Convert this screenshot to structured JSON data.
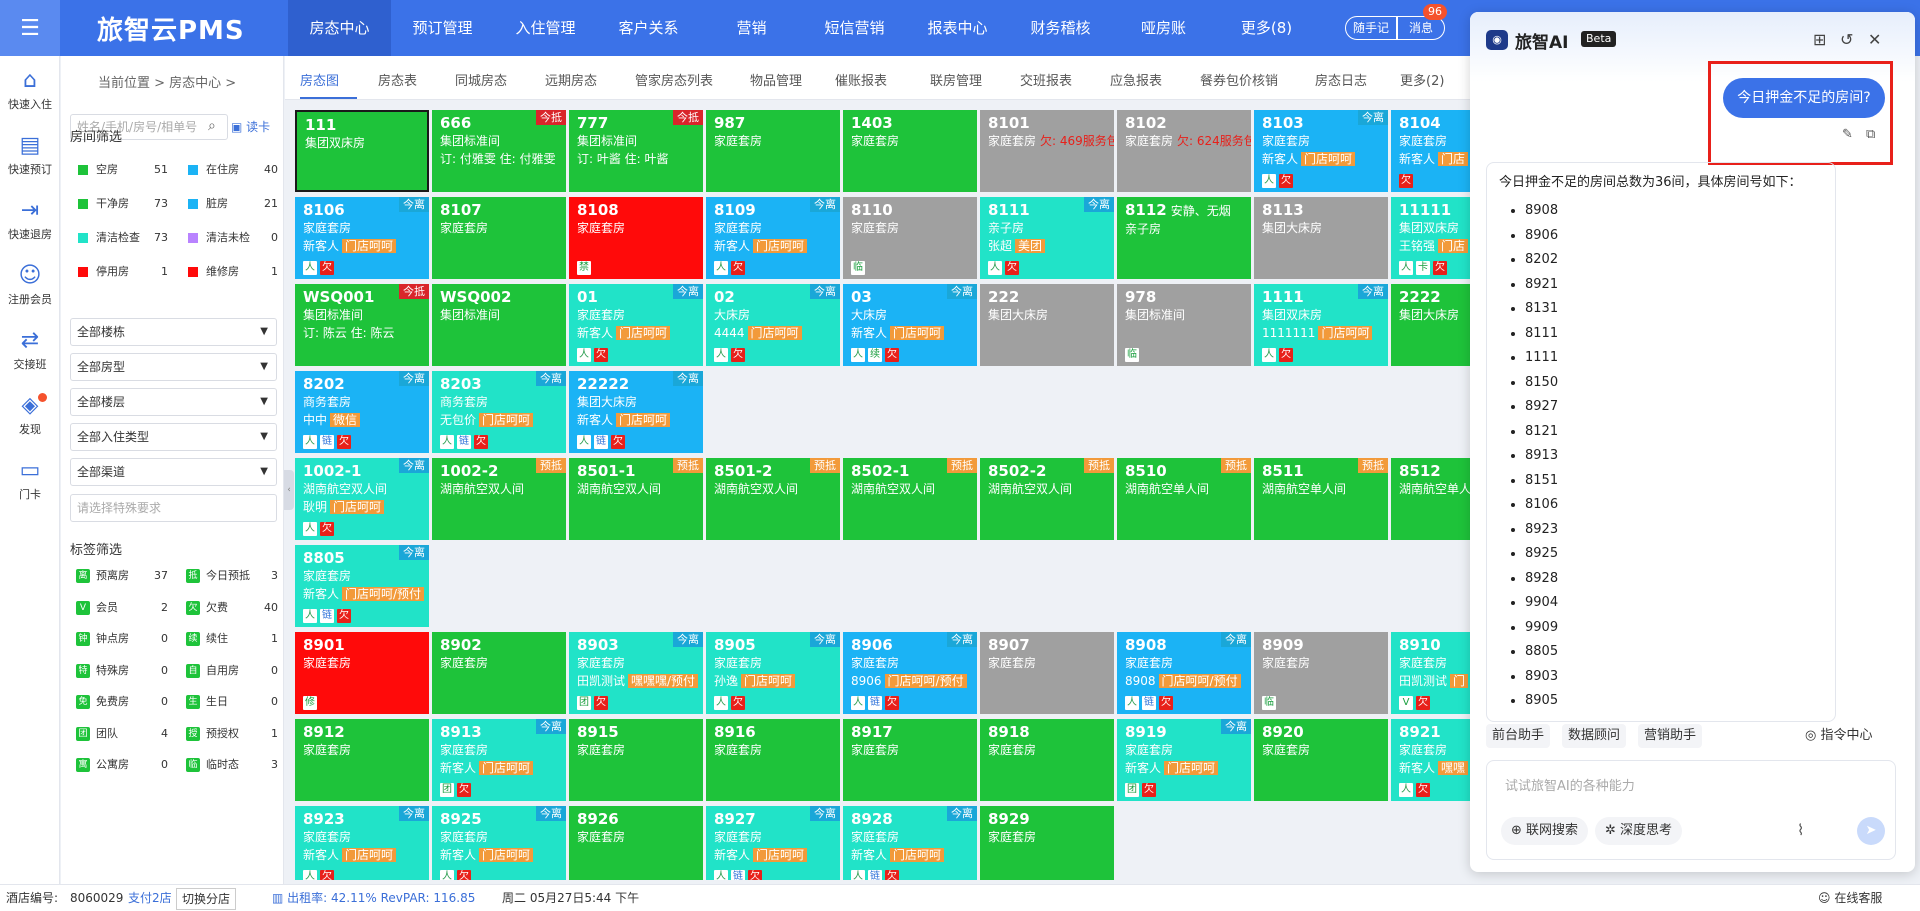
{
  "topbar": {
    "brand": "旅智云PMS",
    "nav": [
      "房态中心",
      "预订管理",
      "入住管理",
      "客户关系",
      "营销",
      "短信营销",
      "报表中心",
      "财务稽核",
      "哑房账",
      "更多(8)"
    ],
    "note_label": "随手记",
    "msg_label": "消息",
    "msg_count": "96",
    "accent_color": "#3b72e8"
  },
  "rail": [
    {
      "icon": "home-icon",
      "label": "快速入住"
    },
    {
      "icon": "booking-icon",
      "label": "快速预订"
    },
    {
      "icon": "checkout-icon",
      "label": "快速退房"
    },
    {
      "icon": "member-icon",
      "label": "注册会员"
    },
    {
      "icon": "shift-icon",
      "label": "交接班"
    },
    {
      "icon": "discover-icon",
      "label": "发现"
    },
    {
      "icon": "card-icon",
      "label": "门卡"
    }
  ],
  "breadcrumb": "当前位置 > 房态中心 >",
  "search": {
    "placeholder": "姓名/手机/房号/相单号",
    "read_card": "读卡"
  },
  "room_filter": {
    "title": "房间筛选",
    "items": [
      {
        "label": "空房",
        "count": "51",
        "color": "#1ec33a"
      },
      {
        "label": "在住房",
        "count": "40",
        "color": "#1bb3f5"
      },
      {
        "label": "干净房",
        "count": "73",
        "color": "#1ec33a"
      },
      {
        "label": "脏房",
        "count": "21",
        "color": "#1bb3f5"
      },
      {
        "label": "清洁检查",
        "count": "73",
        "color": "#21e3c8"
      },
      {
        "label": "清洁未检",
        "count": "0",
        "color": "#b983ff"
      },
      {
        "label": "停用房",
        "count": "1",
        "color": "#ff0a0a"
      },
      {
        "label": "维修房",
        "count": "1",
        "color": "#ff0a0a"
      }
    ]
  },
  "dropdowns": [
    "全部楼栋",
    "全部房型",
    "全部楼层",
    "全部入住类型",
    "全部渠道"
  ],
  "special_placeholder": "请选择特殊要求",
  "tag_filter": {
    "title": "标签筛选",
    "items": [
      {
        "badge": "离",
        "label": "预离房",
        "count": "37",
        "color": "#1ec33a"
      },
      {
        "badge": "抵",
        "label": "今日预抵",
        "count": "3",
        "color": "#1ec33a"
      },
      {
        "badge": "V",
        "label": "会员",
        "count": "2",
        "color": "#1ec33a"
      },
      {
        "badge": "欠",
        "label": "欠费",
        "count": "40",
        "color": "#1ec33a"
      },
      {
        "badge": "钟",
        "label": "钟点房",
        "count": "0",
        "color": "#1ec33a"
      },
      {
        "badge": "续",
        "label": "续住",
        "count": "1",
        "color": "#1ec33a"
      },
      {
        "badge": "特",
        "label": "特殊房",
        "count": "0",
        "color": "#1ec33a"
      },
      {
        "badge": "自",
        "label": "自用房",
        "count": "0",
        "color": "#1ec33a"
      },
      {
        "badge": "免",
        "label": "免费房",
        "count": "0",
        "color": "#1ec33a"
      },
      {
        "badge": "生",
        "label": "生日",
        "count": "0",
        "color": "#1ec33a"
      },
      {
        "badge": "团",
        "label": "团队",
        "count": "4",
        "color": "#1ec33a"
      },
      {
        "badge": "授",
        "label": "预授权",
        "count": "1",
        "color": "#1ec33a"
      },
      {
        "badge": "寓",
        "label": "公寓房",
        "count": "0",
        "color": "#1ec33a"
      },
      {
        "badge": "临",
        "label": "临时态",
        "count": "3",
        "color": "#1ec33a"
      }
    ]
  },
  "subnav": [
    "房态图",
    "房态表",
    "同城房态",
    "远期房态",
    "管家房态列表",
    "物品管理",
    "催账报表",
    "联房管理",
    "交班报表",
    "应急报表",
    "餐券包价核销",
    "房态日志",
    "更多(2)"
  ],
  "rooms": [
    {
      "num": "111",
      "type": "集团双床房",
      "color": "green",
      "selected": true
    },
    {
      "num": "666",
      "type": "集团标准间",
      "guest": "订: 付雅雯 住: 付雅雯",
      "badge": "今抵",
      "badge_color": "red",
      "color": "green"
    },
    {
      "num": "777",
      "type": "集团标准间",
      "guest": "订: 叶酱 住: 叶酱",
      "badge": "今抵",
      "badge_color": "red",
      "color": "green"
    },
    {
      "num": "987",
      "type": "家庭套房",
      "color": "green"
    },
    {
      "num": "1403",
      "type": "家庭套房",
      "color": "green"
    },
    {
      "num": "8101",
      "type": "家庭套房",
      "warn": "欠: 469服务包",
      "color": "gray"
    },
    {
      "num": "8102",
      "type": "家庭套房",
      "warn": "欠: 624服务包",
      "color": "gray"
    },
    {
      "num": "8103",
      "type": "家庭套房",
      "guest": "新客人",
      "gtag": "门店呵呵",
      "icons": [
        "人",
        "欠"
      ],
      "badge": "今离",
      "badge_color": "blue",
      "color": "blue"
    },
    {
      "num": "8104",
      "type": "家庭套房",
      "guest": "新客人",
      "gtag": "门店",
      "icons": [
        "欠"
      ],
      "color": "blue"
    },
    {
      "num": "8106",
      "type": "家庭套房",
      "guest": "新客人",
      "gtag": "门店呵呵",
      "icons": [
        "人",
        "欠"
      ],
      "badge": "今离",
      "badge_color": "blue",
      "color": "blue"
    },
    {
      "num": "8107",
      "type": "家庭套房",
      "color": "green"
    },
    {
      "num": "8108",
      "type": "家庭套房",
      "icons": [
        "禁"
      ],
      "color": "red"
    },
    {
      "num": "8109",
      "type": "家庭套房",
      "guest": "新客人",
      "gtag": "门店呵呵",
      "icons": [
        "人",
        "欠"
      ],
      "badge": "今离",
      "badge_color": "blue",
      "color": "blue"
    },
    {
      "num": "8110",
      "type": "家庭套房",
      "icons": [
        "临"
      ],
      "color": "gray"
    },
    {
      "num": "8111",
      "type": "亲子房",
      "guest": "张超",
      "gtag": "美团",
      "icons": [
        "人",
        "欠"
      ],
      "badge": "今离",
      "badge_color": "blue",
      "color": "cyan"
    },
    {
      "num": "8112",
      "extra": "安静、无烟",
      "type": "亲子房",
      "color": "green"
    },
    {
      "num": "8113",
      "type": "集团大床房",
      "color": "gray"
    },
    {
      "num": "11111",
      "type": "集团双床房",
      "guest": "王铭强",
      "gtag": "门店",
      "icons": [
        "人",
        "卡",
        "欠"
      ],
      "color": "cyan"
    },
    {
      "num": "WSQ001",
      "type": "集团标准间",
      "guest": "订: 陈云 住: 陈云",
      "badge": "今抵",
      "badge_color": "red",
      "color": "green"
    },
    {
      "num": "WSQ002",
      "type": "集团标准间",
      "color": "green"
    },
    {
      "num": "01",
      "type": "家庭套房",
      "guest": "新客人",
      "gtag": "门店呵呵",
      "icons": [
        "人",
        "欠"
      ],
      "badge": "今离",
      "badge_color": "blue",
      "color": "cyan"
    },
    {
      "num": "02",
      "type": "大床房",
      "guest": "4444",
      "gtag": "门店呵呵",
      "icons": [
        "人",
        "欠"
      ],
      "badge": "今离",
      "badge_color": "blue",
      "color": "cyan"
    },
    {
      "num": "03",
      "type": "大床房",
      "guest": "新客人",
      "gtag": "门店呵呵",
      "icons": [
        "人",
        "续",
        "欠"
      ],
      "badge": "今离",
      "badge_color": "blue",
      "color": "blue"
    },
    {
      "num": "222",
      "type": "集团大床房",
      "color": "gray"
    },
    {
      "num": "978",
      "type": "集团标准间",
      "icons": [
        "临"
      ],
      "color": "gray"
    },
    {
      "num": "1111",
      "type": "集团双床房",
      "guest": "1111111",
      "gtag": "门店呵呵",
      "icons": [
        "人",
        "欠"
      ],
      "badge": "今离",
      "badge_color": "blue",
      "color": "cyan"
    },
    {
      "num": "2222",
      "type": "集团大床房",
      "color": "green"
    },
    {
      "num": "8202",
      "type": "商务套房",
      "guest": "中中",
      "gtag": "微信",
      "icons": [
        "人",
        "链",
        "欠"
      ],
      "badge": "今离",
      "badge_color": "blue",
      "color": "blue"
    },
    {
      "num": "8203",
      "type": "商务套房",
      "guest": "无包价",
      "gtag": "门店呵呵",
      "icons": [
        "人",
        "链",
        "欠"
      ],
      "badge": "今离",
      "badge_color": "blue",
      "color": "cyan"
    },
    {
      "num": "22222",
      "type": "集团大床房",
      "guest": "新客人",
      "gtag": "门店呵呵",
      "icons": [
        "人",
        "链",
        "欠"
      ],
      "badge": "今离",
      "badge_color": "blue",
      "color": "blue"
    },
    {
      "num": "1002-1",
      "type": "湖南航空双人间",
      "guest": "耿明",
      "gtag": "门店呵呵",
      "icons": [
        "人",
        "欠"
      ],
      "badge": "今离",
      "badge_color": "blue",
      "color": "cyan"
    },
    {
      "num": "1002-2",
      "type": "湖南航空双人间",
      "badge": "预抵",
      "badge_color": "orange",
      "color": "green"
    },
    {
      "num": "8501-1",
      "type": "湖南航空双人间",
      "badge": "预抵",
      "badge_color": "orange",
      "color": "green"
    },
    {
      "num": "8501-2",
      "type": "湖南航空双人间",
      "badge": "预抵",
      "badge_color": "orange",
      "color": "green"
    },
    {
      "num": "8502-1",
      "type": "湖南航空双人间",
      "badge": "预抵",
      "badge_color": "orange",
      "color": "green"
    },
    {
      "num": "8502-2",
      "type": "湖南航空双人间",
      "badge": "预抵",
      "badge_color": "orange",
      "color": "green"
    },
    {
      "num": "8510",
      "type": "湖南航空单人间",
      "badge": "预抵",
      "badge_color": "orange",
      "color": "green"
    },
    {
      "num": "8511",
      "type": "湖南航空单人间",
      "badge": "预抵",
      "badge_color": "orange",
      "color": "green"
    },
    {
      "num": "8512",
      "type": "湖南航空单人间",
      "color": "green"
    },
    {
      "num": "8805",
      "type": "家庭套房",
      "guest": "新客人",
      "gtag": "门店呵呵/预付",
      "icons": [
        "人",
        "链",
        "欠"
      ],
      "badge": "今离",
      "badge_color": "blue",
      "color": "cyan"
    },
    {
      "num": "8901",
      "type": "家庭套房",
      "icons": [
        "修"
      ],
      "color": "red"
    },
    {
      "num": "8902",
      "type": "家庭套房",
      "color": "green"
    },
    {
      "num": "8903",
      "type": "家庭套房",
      "guest": "田凯测试",
      "gtag": "嘿嘿嘿/预付",
      "icons": [
        "团",
        "欠"
      ],
      "badge": "今离",
      "badge_color": "blue",
      "color": "cyan"
    },
    {
      "num": "8905",
      "type": "家庭套房",
      "guest": "孙逸",
      "gtag": "门店呵呵",
      "icons": [
        "人",
        "欠"
      ],
      "badge": "今离",
      "badge_color": "blue",
      "color": "cyan"
    },
    {
      "num": "8906",
      "type": "家庭套房",
      "guest": "8906",
      "gtag": "门店呵呵/预付",
      "icons": [
        "人",
        "链",
        "欠"
      ],
      "badge": "今离",
      "badge_color": "blue",
      "color": "blue"
    },
    {
      "num": "8907",
      "type": "家庭套房",
      "color": "gray"
    },
    {
      "num": "8908",
      "type": "家庭套房",
      "guest": "8908",
      "gtag": "门店呵呵/预付",
      "icons": [
        "人",
        "链",
        "欠"
      ],
      "badge": "今离",
      "badge_color": "blue",
      "color": "blue"
    },
    {
      "num": "8909",
      "type": "家庭套房",
      "icons": [
        "临"
      ],
      "color": "gray"
    },
    {
      "num": "8910",
      "type": "家庭套房",
      "guest": "田凯测试",
      "gtag": "门",
      "icons": [
        "V",
        "欠"
      ],
      "color": "cyan"
    },
    {
      "num": "8912",
      "type": "家庭套房",
      "color": "green"
    },
    {
      "num": "8913",
      "type": "家庭套房",
      "guest": "新客人",
      "gtag": "门店呵呵",
      "icons": [
        "团",
        "欠"
      ],
      "badge": "今离",
      "badge_color": "blue",
      "color": "cyan"
    },
    {
      "num": "8915",
      "type": "家庭套房",
      "color": "green"
    },
    {
      "num": "8916",
      "type": "家庭套房",
      "color": "green"
    },
    {
      "num": "8917",
      "type": "家庭套房",
      "color": "green"
    },
    {
      "num": "8918",
      "type": "家庭套房",
      "color": "green"
    },
    {
      "num": "8919",
      "type": "家庭套房",
      "guest": "新客人",
      "gtag": "门店呵呵",
      "icons": [
        "团",
        "欠"
      ],
      "badge": "今离",
      "badge_color": "blue",
      "color": "cyan"
    },
    {
      "num": "8920",
      "type": "家庭套房",
      "color": "green"
    },
    {
      "num": "8921",
      "type": "家庭套房",
      "guest": "新客人",
      "gtag": "嘿嘿",
      "icons": [
        "人",
        "欠"
      ],
      "color": "cyan"
    },
    {
      "num": "8923",
      "type": "家庭套房",
      "guest": "新客人",
      "gtag": "门店呵呵",
      "icons": [
        "人",
        "欠"
      ],
      "badge": "今离",
      "badge_color": "blue",
      "color": "cyan"
    },
    {
      "num": "8925",
      "type": "家庭套房",
      "guest": "新客人",
      "gtag": "门店呵呵",
      "icons": [
        "人",
        "欠"
      ],
      "badge": "今离",
      "badge_color": "blue",
      "color": "cyan"
    },
    {
      "num": "8926",
      "type": "家庭套房",
      "color": "green"
    },
    {
      "num": "8927",
      "type": "家庭套房",
      "guest": "新客人",
      "gtag": "门店呵呵",
      "icons": [
        "人",
        "链",
        "欠"
      ],
      "badge": "今离",
      "badge_color": "blue",
      "color": "cyan"
    },
    {
      "num": "8928",
      "type": "家庭套房",
      "guest": "新客人",
      "gtag": "门店呵呵",
      "icons": [
        "人",
        "链",
        "欠"
      ],
      "badge": "今离",
      "badge_color": "blue",
      "color": "cyan"
    },
    {
      "num": "8929",
      "type": "家庭套房",
      "color": "green"
    }
  ],
  "ai": {
    "title": "旅智AI",
    "beta": "Beta",
    "question": "今日押金不足的房间?",
    "answer_intro": "今日押金不足的房间总数为36间，具体房间号如下：",
    "room_list": [
      "8908",
      "8906",
      "8202",
      "8921",
      "8131",
      "8111",
      "1111",
      "8150",
      "8927",
      "8121",
      "8913",
      "8151",
      "8106",
      "8923",
      "8925",
      "8928",
      "9904",
      "9909",
      "8805",
      "8903",
      "8905"
    ],
    "chips": [
      "前台助手",
      "数据顾问",
      "营销助手"
    ],
    "command_center": "指令中心",
    "input_placeholder": "试试旅智AI的各种能力",
    "web_search": "联网搜索",
    "deep_think": "深度思考"
  },
  "bottombar": {
    "hotel_no_label": "酒店编号:",
    "hotel_no": "8060029",
    "branch_pay": "支付2店",
    "switch_store": "切换分店",
    "occupancy": "出租率: 42.11% RevPAR: 116.85",
    "datetime": "周二 05月27日5:44 下午",
    "support": "在线客服"
  }
}
